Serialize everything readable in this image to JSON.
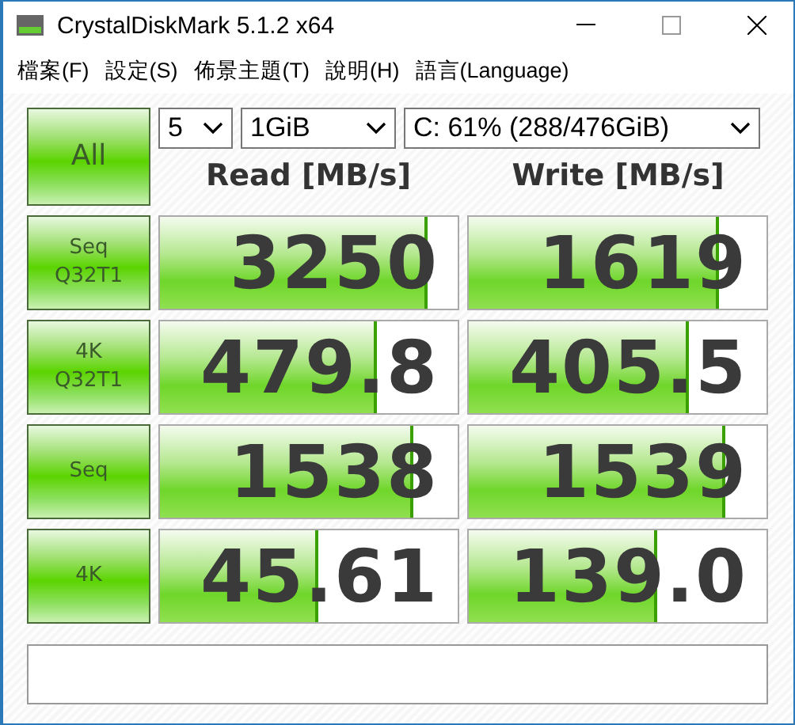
{
  "window": {
    "title": "CrystalDiskMark 5.1.2 x64"
  },
  "menu": [
    "檔案(F)",
    "設定(S)",
    "佈景主題(T)",
    "說明(H)",
    "語言(Language)"
  ],
  "all_button": "All",
  "selects": [
    {
      "value": "5"
    },
    {
      "value": "1GiB"
    },
    {
      "value": "C: 61% (288/476GiB)"
    }
  ],
  "headers": [
    "Read [MB/s]",
    "Write [MB/s]"
  ],
  "tests": [
    {
      "label": "Seq\nQ32T1",
      "read": {
        "value": "3250",
        "level": 0.89
      },
      "write": {
        "value": "1619",
        "level": 0.83
      }
    },
    {
      "label": "4K\nQ32T1",
      "read": {
        "value": "479.8",
        "level": 0.72
      },
      "write": {
        "value": "405.5",
        "level": 0.73
      }
    },
    {
      "label": "Seq",
      "read": {
        "value": "1538",
        "level": 0.84
      },
      "write": {
        "value": "1539",
        "level": 0.85
      }
    },
    {
      "label": "4K",
      "read": {
        "value": "45.61",
        "level": 0.52
      },
      "write": {
        "value": "139.0",
        "level": 0.62
      }
    }
  ]
}
